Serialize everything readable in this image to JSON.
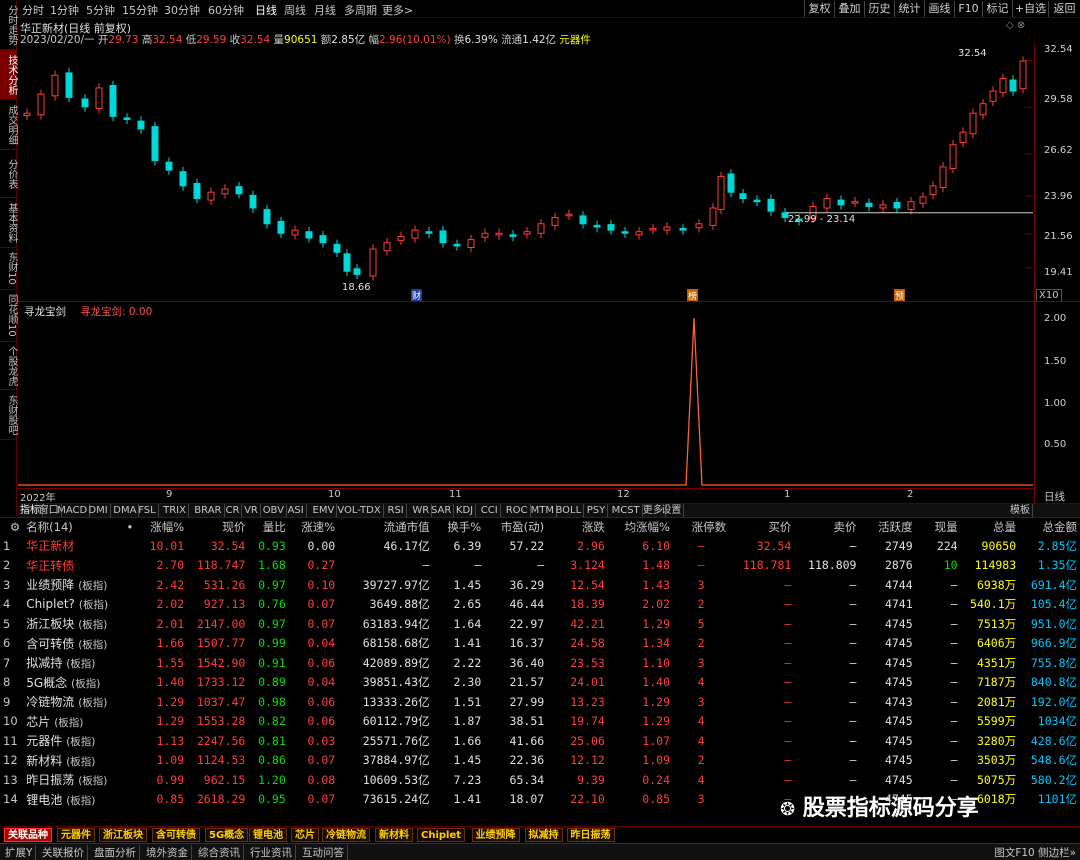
{
  "left_tabs": [
    "分时走势",
    "技术分析",
    "成交明细",
    "分价表",
    "基本资料",
    "东财10",
    "同花顺10",
    "个股龙虎",
    "东财股吧"
  ],
  "period_bar": {
    "items": [
      "分时",
      "1分钟",
      "5分钟",
      "15分钟",
      "30分钟",
      "60分钟",
      "日线",
      "周线",
      "月线",
      "多周期",
      "更多>"
    ],
    "selected": "日线",
    "right_buttons": [
      "复权",
      "叠加",
      "历史",
      "统计",
      "画线",
      "F10",
      "标记",
      "+自选",
      "返回"
    ]
  },
  "chart_header": {
    "title": "华正新材(日线 前复权)",
    "date": "2023/02/20/一",
    "open_label": "开",
    "open": "29.73",
    "high_label": "高",
    "high": "32.54",
    "low_label": "低",
    "low": "29.59",
    "close_label": "收",
    "close": "32.54",
    "vol_label": "量",
    "vol": "90651",
    "amount_label": "额",
    "amount": "2.85亿",
    "change_label": "幅",
    "change": "2.96(10.01%)",
    "turnover_label": "换",
    "turnover": "6.39%",
    "float_label": "流通",
    "float": "1.42亿",
    "industry": "元器件"
  },
  "price_axis": [
    "32.54",
    "29.58",
    "26.62",
    "23.96",
    "21.56",
    "19.41"
  ],
  "chart_annotations": {
    "low_marker": "18.66",
    "high_marker": "32.54",
    "range_label": "22.99 - 23.14",
    "badge_cai": "财",
    "badge_bang": "榜",
    "badge_yu": "预",
    "scale": "X10"
  },
  "sub_chart": {
    "title": "寻龙宝剑",
    "value_label": "寻龙宝剑: 0.00",
    "axis": [
      "2.00",
      "1.50",
      "1.00",
      "0.50"
    ]
  },
  "time_axis": [
    "2022年",
    "9",
    "10",
    "11",
    "12",
    "1",
    "2"
  ],
  "time_axis_right": "日线",
  "indicator_tabs": [
    "指标",
    "窗口",
    "MACD",
    "DMI",
    "DMA",
    "FSL",
    "TRIX",
    "BRAR",
    "CR",
    "VR",
    "OBV",
    "ASI",
    "EMV",
    "VOL-TDX",
    "RSI",
    "WR",
    "SAR",
    "KDJ",
    "CCI",
    "ROC",
    "MTM",
    "BOLL",
    "PSY",
    "MCST",
    "更多",
    "设置"
  ],
  "indicator_right": "模板",
  "table": {
    "headers": [
      "名称(14)",
      "•",
      "涨幅%",
      "现价",
      "量比",
      "涨速%",
      "流通市值",
      "换手%",
      "市盈(动)",
      "涨跌",
      "均涨幅%",
      "涨停数",
      "买价",
      "卖价",
      "活跃度",
      "现量",
      "总量",
      "总金额"
    ],
    "rows": [
      {
        "idx": "1",
        "name": "华正新材",
        "tag": "",
        "zf": "10.01",
        "xj": "32.54",
        "lb": "0.93",
        "zs": "0.00",
        "ltsz": "46.17亿",
        "hs": "6.39",
        "sy": "57.22",
        "zd": "2.96",
        "jzf": "6.10",
        "zts": "–",
        "mj": "32.54",
        "mc": "–",
        "hyd": "2749",
        "xl": "224",
        "zl": "90650",
        "zje": "2.85亿"
      },
      {
        "idx": "2",
        "name": "华正转债",
        "tag": "",
        "zf": "2.70",
        "xj": "118.747",
        "lb": "1.68",
        "zs": "0.27",
        "ltsz": "–",
        "hs": "–",
        "sy": "–",
        "zd": "3.124",
        "jzf": "1.48",
        "zts": "–",
        "mj": "118.781",
        "mc": "118.809",
        "hyd": "2876",
        "xl": "10",
        "zl": "114983",
        "zje": "1.35亿"
      },
      {
        "idx": "3",
        "name": "业绩预降",
        "tag": "(板指)",
        "zf": "2.42",
        "xj": "531.26",
        "lb": "0.97",
        "zs": "0.10",
        "ltsz": "39727.97亿",
        "hs": "1.45",
        "sy": "36.29",
        "zd": "12.54",
        "jzf": "1.43",
        "zts": "3",
        "mj": "–",
        "mc": "–",
        "hyd": "4744",
        "xl": "–",
        "zl": "6938万",
        "zje": "691.4亿"
      },
      {
        "idx": "4",
        "name": "Chiplet?",
        "tag": "(板指)",
        "zf": "2.02",
        "xj": "927.13",
        "lb": "0.76",
        "zs": "0.07",
        "ltsz": "3649.88亿",
        "hs": "2.65",
        "sy": "46.44",
        "zd": "18.39",
        "jzf": "2.02",
        "zts": "2",
        "mj": "–",
        "mc": "–",
        "hyd": "4741",
        "xl": "–",
        "zl": "540.1万",
        "zje": "105.4亿"
      },
      {
        "idx": "5",
        "name": "浙江板块",
        "tag": "(板指)",
        "zf": "2.01",
        "xj": "2147.00",
        "lb": "0.97",
        "zs": "0.07",
        "ltsz": "63183.94亿",
        "hs": "1.64",
        "sy": "22.97",
        "zd": "42.21",
        "jzf": "1.29",
        "zts": "5",
        "mj": "–",
        "mc": "–",
        "hyd": "4745",
        "xl": "–",
        "zl": "7513万",
        "zje": "951.0亿"
      },
      {
        "idx": "6",
        "name": "含可转债",
        "tag": "(板指)",
        "zf": "1.66",
        "xj": "1507.77",
        "lb": "0.99",
        "zs": "0.04",
        "ltsz": "68158.68亿",
        "hs": "1.41",
        "sy": "16.37",
        "zd": "24.58",
        "jzf": "1.34",
        "zts": "2",
        "mj": "–",
        "mc": "–",
        "hyd": "4745",
        "xl": "–",
        "zl": "6406万",
        "zje": "966.9亿"
      },
      {
        "idx": "7",
        "name": "拟减持",
        "tag": "(板指)",
        "zf": "1.55",
        "xj": "1542.90",
        "lb": "0.91",
        "zs": "0.06",
        "ltsz": "42089.89亿",
        "hs": "2.22",
        "sy": "36.40",
        "zd": "23.53",
        "jzf": "1.10",
        "zts": "3",
        "mj": "–",
        "mc": "–",
        "hyd": "4745",
        "xl": "–",
        "zl": "4351万",
        "zje": "755.8亿"
      },
      {
        "idx": "8",
        "name": "5G概念",
        "tag": "(板指)",
        "zf": "1.40",
        "xj": "1733.12",
        "lb": "0.89",
        "zs": "0.04",
        "ltsz": "39851.43亿",
        "hs": "2.30",
        "sy": "21.57",
        "zd": "24.01",
        "jzf": "1.40",
        "zts": "4",
        "mj": "–",
        "mc": "–",
        "hyd": "4745",
        "xl": "–",
        "zl": "7187万",
        "zje": "840.8亿"
      },
      {
        "idx": "9",
        "name": "冷链物流",
        "tag": "(板指)",
        "zf": "1.29",
        "xj": "1037.47",
        "lb": "0.98",
        "zs": "0.06",
        "ltsz": "13333.26亿",
        "hs": "1.51",
        "sy": "27.99",
        "zd": "13.23",
        "jzf": "1.29",
        "zts": "3",
        "mj": "–",
        "mc": "–",
        "hyd": "4743",
        "xl": "–",
        "zl": "2081万",
        "zje": "192.0亿"
      },
      {
        "idx": "10",
        "name": "芯片",
        "tag": "(板指)",
        "zf": "1.29",
        "xj": "1553.28",
        "lb": "0.82",
        "zs": "0.06",
        "ltsz": "60112.79亿",
        "hs": "1.87",
        "sy": "38.51",
        "zd": "19.74",
        "jzf": "1.29",
        "zts": "4",
        "mj": "–",
        "mc": "–",
        "hyd": "4745",
        "xl": "–",
        "zl": "5599万",
        "zje": "1034亿"
      },
      {
        "idx": "11",
        "name": "元器件",
        "tag": "(板指)",
        "zf": "1.13",
        "xj": "2247.56",
        "lb": "0.81",
        "zs": "0.03",
        "ltsz": "25571.76亿",
        "hs": "1.66",
        "sy": "41.66",
        "zd": "25.06",
        "jzf": "1.07",
        "zts": "4",
        "mj": "–",
        "mc": "–",
        "hyd": "4745",
        "xl": "–",
        "zl": "3280万",
        "zje": "428.6亿"
      },
      {
        "idx": "12",
        "name": "新材料",
        "tag": "(板指)",
        "zf": "1.09",
        "xj": "1124.53",
        "lb": "0.86",
        "zs": "0.07",
        "ltsz": "37884.97亿",
        "hs": "1.45",
        "sy": "22.36",
        "zd": "12.12",
        "jzf": "1.09",
        "zts": "2",
        "mj": "–",
        "mc": "–",
        "hyd": "4745",
        "xl": "–",
        "zl": "3503万",
        "zje": "548.6亿"
      },
      {
        "idx": "13",
        "name": "昨日振荡",
        "tag": "(板指)",
        "zf": "0.99",
        "xj": "962.15",
        "lb": "1.20",
        "zs": "0.08",
        "ltsz": "10609.53亿",
        "hs": "7.23",
        "sy": "65.34",
        "zd": "9.39",
        "jzf": "0.24",
        "zts": "4",
        "mj": "–",
        "mc": "–",
        "hyd": "4745",
        "xl": "–",
        "zl": "5075万",
        "zje": "580.2亿"
      },
      {
        "idx": "14",
        "name": "锂电池",
        "tag": "(板指)",
        "zf": "0.85",
        "xj": "2618.29",
        "lb": "0.95",
        "zs": "0.07",
        "ltsz": "73615.24亿",
        "hs": "1.41",
        "sy": "18.07",
        "zd": "22.10",
        "jzf": "0.85",
        "zts": "3",
        "mj": "–",
        "mc": "–",
        "hyd": "4745",
        "xl": "–",
        "zl": "6018万",
        "zje": "1101亿"
      }
    ]
  },
  "bottom_tabs": [
    "关联品种",
    "元器件",
    "浙江板块",
    "含可转债",
    "5G概念",
    "锂电池",
    "芯片",
    "冷链物流",
    "新材料",
    "Chiplet",
    "业绩预降",
    "拟减持",
    "昨日振荡"
  ],
  "status_bar": [
    "扩展Y",
    "关联报价",
    "盘面分析",
    "境外资金",
    "综合资讯",
    "行业资讯",
    "互动问答"
  ],
  "status_right": "图文F10 侧边栏»",
  "watermark": "股票指标源码分享",
  "colors": {
    "up": "#ff3c3c",
    "down": "#00d8d8",
    "bg": "#000000",
    "accent": "#b00000"
  }
}
